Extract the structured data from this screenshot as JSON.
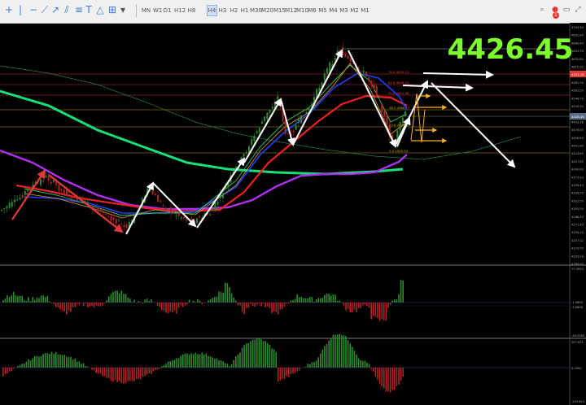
{
  "toolbar": {
    "tools": [
      "crosshair-icon",
      "vertical-line-icon",
      "horizontal-line-icon",
      "trendline-icon",
      "ray-icon",
      "channel-icon",
      "fibonacci-icon",
      "text-icon",
      "shapes-icon",
      "layout-icon"
    ],
    "timeframes": [
      "MN",
      "W1",
      "D1",
      "H12",
      "H8",
      "H4",
      "H3",
      "H2",
      "H1",
      "M30",
      "M20",
      "M15",
      "M12",
      "M10",
      "M6",
      "M5",
      "M4",
      "M3",
      "M2",
      "M1"
    ],
    "active_timeframe": "H4",
    "notification_count": "1"
  },
  "price_overlay": "4426.45",
  "price_axis": [
    "4704.30",
    "4691.85",
    "4669.40",
    "4653.70",
    "4632.80",
    "4615.35",
    "4598.35",
    "4581.20",
    "4563.55",
    "4546.75",
    "4529.30",
    "4510.40",
    "4493.36",
    "4476.55",
    "4458.85",
    "4441.80",
    "4424.65",
    "4407.85",
    "4390.00",
    "4373.33",
    "4356.40",
    "4339.55",
    "4322.50",
    "4305.50",
    "4288.45",
    "4271.45",
    "4254.15",
    "4237.12",
    "4220.05",
    "4203.26",
    "4186.00"
  ],
  "fib_levels": [
    {
      "label": "76.4  4655.21",
      "price": "4655.21",
      "color": "#ff3b3b"
    },
    {
      "label": "61.8  4626.03",
      "price": "4626.03",
      "color": "#ff3b3b"
    },
    {
      "label": "50.0  4601.98",
      "price": "4601.98",
      "color": "#ff3b3b"
    },
    {
      "label": "38.2  4580.77",
      "price": "4580.77",
      "color": "#e5b400"
    },
    {
      "label": "23.6  4555.91",
      "price": "4555.91",
      "color": "#e5b400"
    },
    {
      "label": "0.0  4509.34",
      "price": "4509.34",
      "color": "#e5b400"
    }
  ],
  "price_tags": [
    {
      "text": "4432.18",
      "color": "#e53935"
    },
    {
      "text": "4426.45",
      "color": "#5a6e8a"
    }
  ],
  "osc1_axis": [
    "77.3933",
    "-1.9800",
    "-3.8808",
    "-46.4280"
  ],
  "osc2_axis": [
    "207.611",
    "0.0000",
    "-257.615"
  ],
  "colors": {
    "overlay_price": "#7cff2a",
    "ema_green": "#17e07a",
    "ema_purple": "#b02ff0",
    "ema_red": "#ee2020",
    "ema_blue": "#2040ff",
    "arrow": "#ffffff",
    "arrow_red": "#e23a3a",
    "arrow_orange": "#ffb020",
    "bull_candle": "#2e8b2e",
    "bear_candle": "#b22222"
  }
}
